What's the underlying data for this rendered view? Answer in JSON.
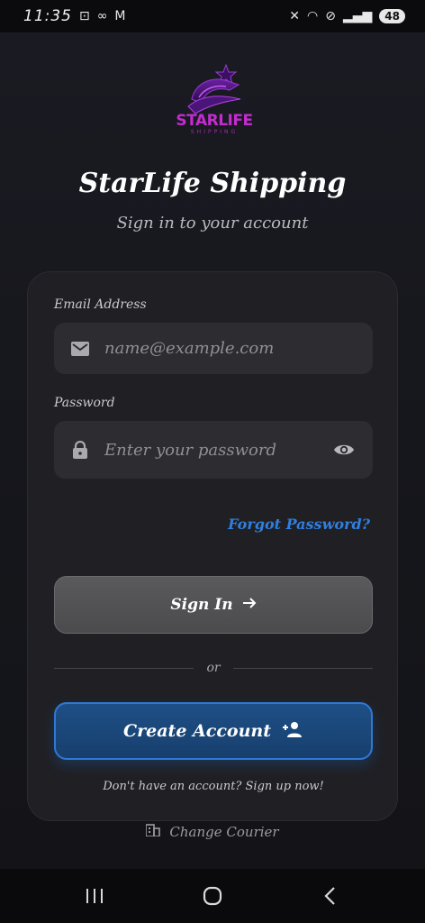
{
  "status_bar": {
    "time": "11:35",
    "battery": "48"
  },
  "header": {
    "logo_text": "STARLIFE",
    "logo_subtext": "SHIPPING",
    "title": "StarLife Shipping",
    "subtitle": "Sign in to your account"
  },
  "form": {
    "email_label": "Email Address",
    "email_placeholder": "name@example.com",
    "password_label": "Password",
    "password_placeholder": "Enter your password",
    "forgot_password": "Forgot Password?",
    "sign_in_label": "Sign In",
    "divider_text": "or",
    "create_account_label": "Create Account",
    "signup_hint": "Don't have an account? Sign up now!"
  },
  "footer": {
    "change_courier": "Change Courier"
  },
  "colors": {
    "background": "#15161b",
    "card": "#202024",
    "accent_blue": "#2f7fe0",
    "logo_purple": "#c42bd0"
  },
  "icons": {
    "email": "mail-icon",
    "password": "lock-icon",
    "visibility": "eye-icon",
    "sign_in": "arrow-right-icon",
    "create": "person-add-icon",
    "courier": "building-icon"
  }
}
